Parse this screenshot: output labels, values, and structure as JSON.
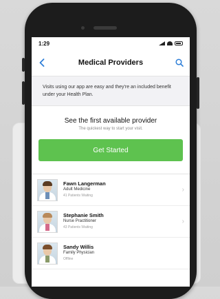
{
  "status_bar": {
    "time": "1:29"
  },
  "navigation": {
    "title": "Medical Providers",
    "back_icon": "chevron-left-icon",
    "search_icon": "search-icon"
  },
  "intro": {
    "text": "Visits using our app are easy and they're an included benefit under your Health Plan."
  },
  "cta": {
    "title": "See the first available provider",
    "subtitle": "The quickest way to start your visit.",
    "button_label": "Get Started",
    "button_color": "#5ec24f"
  },
  "providers": [
    {
      "name": "Fawn Langerman",
      "role": "Adult Medicine",
      "status": "41 Patients Waiting"
    },
    {
      "name": "Stephanie Smith",
      "role": "Nurse Practitioner",
      "status": "43 Patients Waiting"
    },
    {
      "name": "Sandy Willis",
      "role": "Family Physician",
      "status": "Offline"
    }
  ]
}
